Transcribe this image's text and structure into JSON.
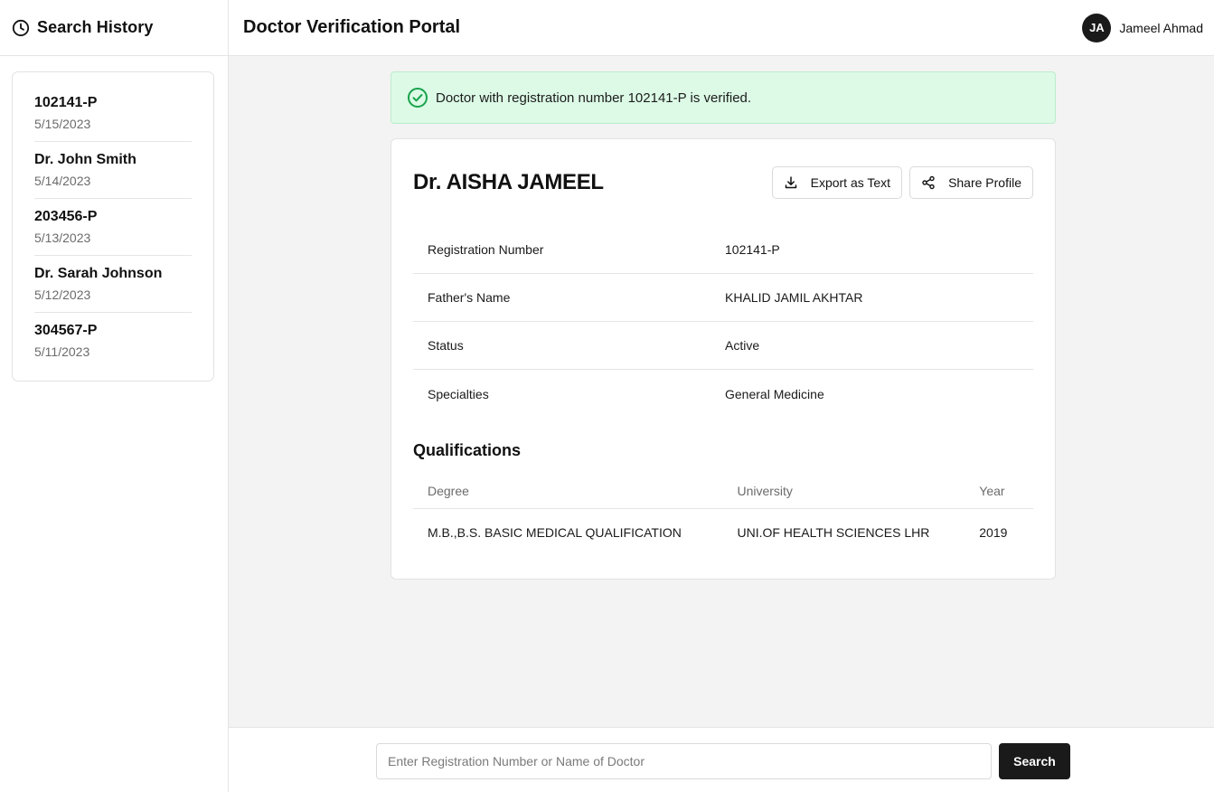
{
  "sidebar": {
    "title": "Search History",
    "items": [
      {
        "query": "102141-P",
        "date": "5/15/2023"
      },
      {
        "query": "Dr. John Smith",
        "date": "5/14/2023"
      },
      {
        "query": "203456-P",
        "date": "5/13/2023"
      },
      {
        "query": "Dr. Sarah Johnson",
        "date": "5/12/2023"
      },
      {
        "query": "304567-P",
        "date": "5/11/2023"
      }
    ]
  },
  "header": {
    "title": "Doctor Verification Portal",
    "user": {
      "initials": "JA",
      "name": "Jameel Ahmad"
    }
  },
  "alert": {
    "text": "Doctor with registration number 102141-P is verified.",
    "icon": "check-circle-icon",
    "color": "#16a34a"
  },
  "profile": {
    "name": "Dr. AISHA JAMEEL",
    "actions": {
      "export_label": "Export as Text",
      "share_label": "Share Profile"
    },
    "fields": [
      {
        "label": "Registration Number",
        "value": "102141-P"
      },
      {
        "label": "Father's Name",
        "value": "KHALID JAMIL AKHTAR"
      },
      {
        "label": "Status",
        "value": "Active"
      },
      {
        "label": "Specialties",
        "value": "General Medicine"
      }
    ],
    "qualifications": {
      "title": "Qualifications",
      "columns": [
        "Degree",
        "University",
        "Year"
      ],
      "rows": [
        [
          "M.B.,B.S. BASIC MEDICAL QUALIFICATION",
          "UNI.OF HEALTH SCIENCES LHR",
          "2019"
        ]
      ]
    }
  },
  "search": {
    "placeholder": "Enter Registration Number or Name of Doctor",
    "value": "",
    "button_label": "Search"
  }
}
